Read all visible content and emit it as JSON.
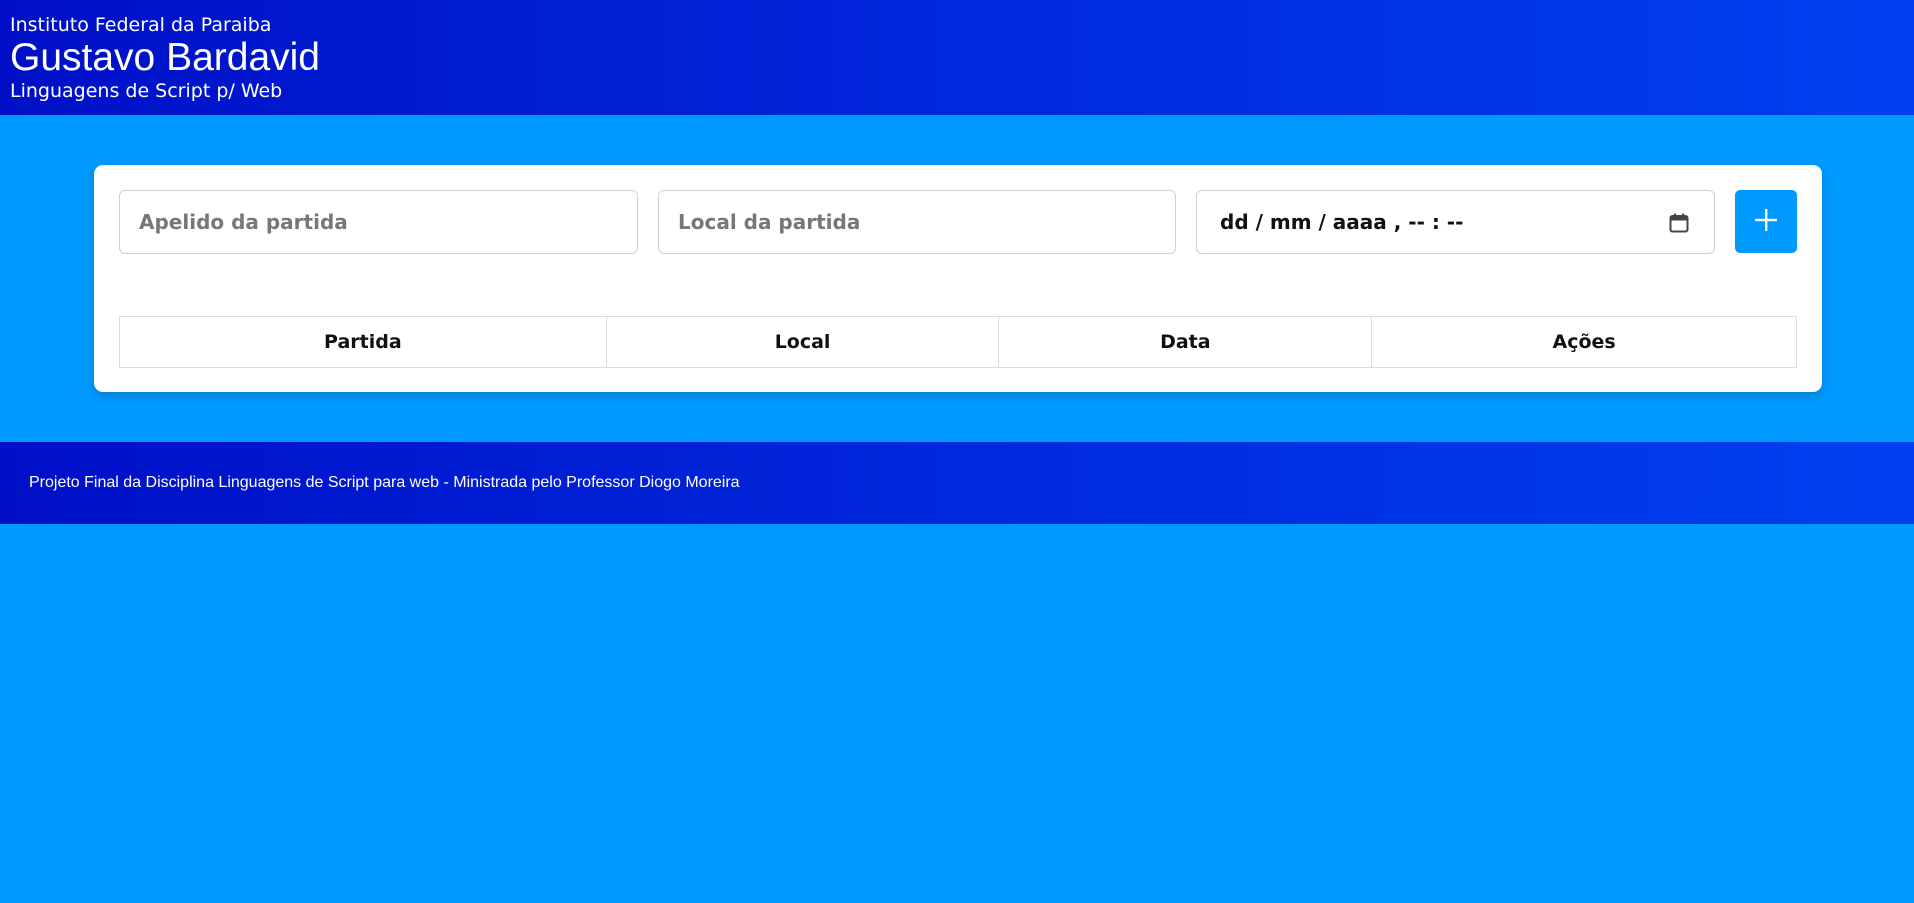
{
  "header": {
    "institute": "Instituto Federal da Paraiba",
    "name": "Gustavo Bardavid",
    "course": "Linguagens de Script p/ Web"
  },
  "form": {
    "nickname_placeholder": "Apelido da partida",
    "location_placeholder": "Local da partida",
    "datetime_display": "dd / mm / aaaa ,  -- : --",
    "add_button_icon": "plus-icon"
  },
  "table": {
    "headers": [
      "Partida",
      "Local",
      "Data",
      "Ações"
    ],
    "rows": []
  },
  "footer": {
    "text": "Projeto Final da Disciplina Linguagens de Script para web - Ministrada pelo Professor Diogo Moreira"
  },
  "colors": {
    "background": "#0099ff",
    "header_gradient_start": "#0010c8",
    "header_gradient_end": "#0040f0",
    "button": "#0099ff"
  }
}
